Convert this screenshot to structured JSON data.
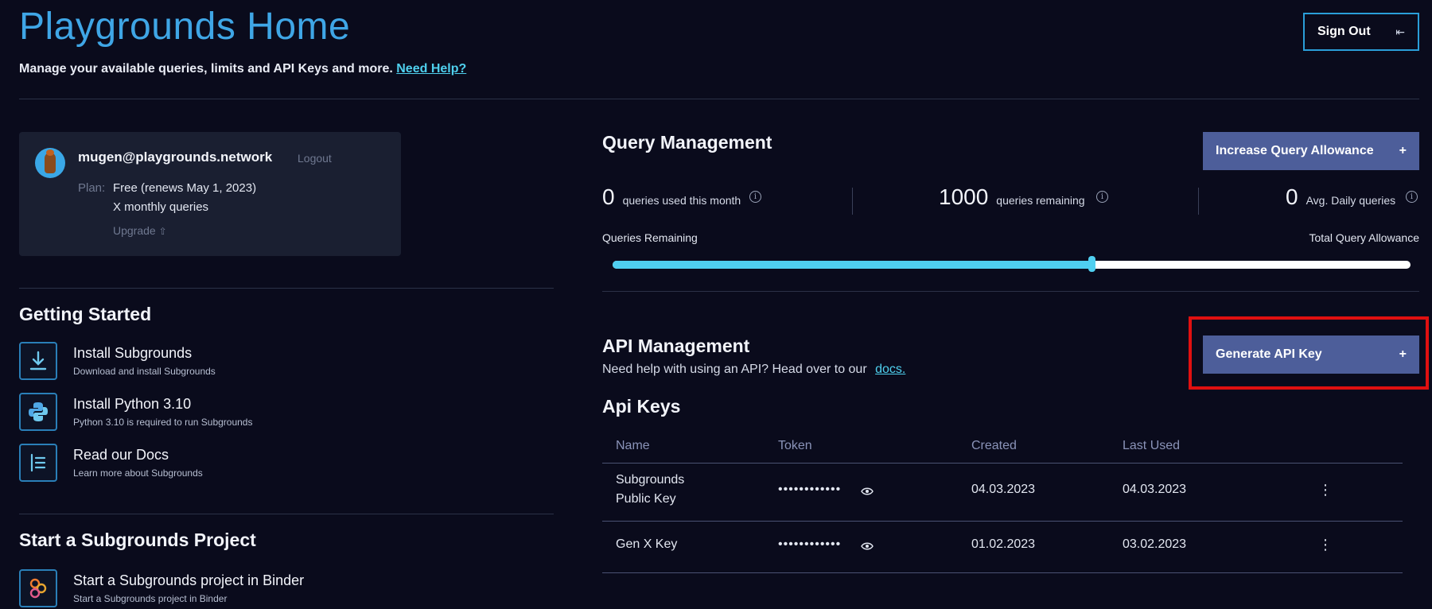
{
  "header": {
    "title": "Playgrounds Home",
    "subtitle": "Manage your available queries, limits and API Keys and more.",
    "help_link": "Need Help?",
    "signout_label": "Sign Out",
    "signout_icon": "exit-arrow-icon"
  },
  "user_card": {
    "email": "mugen@playgrounds.network",
    "logout_label": "Logout",
    "plan_label": "Plan:",
    "plan_value": "Free (renews May 1, 2023)",
    "plan_queries": "X monthly queries",
    "upgrade_label": "Upgrade"
  },
  "getting_started": {
    "heading": "Getting Started",
    "items": [
      {
        "title": "Install Subgrounds",
        "subtitle": "Download and install Subgrounds",
        "icon": "download-icon"
      },
      {
        "title": "Install Python 3.10",
        "subtitle": "Python 3.10 is required to run Subgrounds",
        "icon": "python-icon"
      },
      {
        "title": "Read our Docs",
        "subtitle": "Learn more about Subgrounds",
        "icon": "docs-icon"
      }
    ]
  },
  "project": {
    "heading": "Start a Subgrounds Project",
    "items": [
      {
        "title": "Start a Subgrounds project in Binder",
        "subtitle": "Start a Subgrounds project in Binder",
        "icon": "binder-icon"
      }
    ]
  },
  "query_management": {
    "heading": "Query Management",
    "increase_label": "Increase Query Allowance",
    "stats": [
      {
        "value": "0",
        "label": "queries used this month"
      },
      {
        "value": "1000",
        "label": "queries remaining"
      },
      {
        "value": "0",
        "label": "Avg. Daily queries"
      }
    ],
    "slider_left_label": "Queries Remaining",
    "slider_right_label": "Total Query Allowance",
    "slider_fraction": 0.6
  },
  "api_management": {
    "heading": "API Management",
    "help_text": "Need help with using an API? Head over to our",
    "docs_link": "docs.",
    "generate_label": "Generate API Key",
    "keys_heading": "Api Keys",
    "columns": [
      "Name",
      "Token",
      "Created",
      "Last Used"
    ],
    "rows": [
      {
        "name_line1": "Subgrounds",
        "name_line2": "Public Key",
        "token": "••••••••••••",
        "created": "04.03.2023",
        "last_used": "04.03.2023"
      },
      {
        "name_line1": "Gen X Key",
        "name_line2": "",
        "token": "••••••••••••",
        "created": "01.02.2023",
        "last_used": "03.02.2023"
      }
    ]
  },
  "colors": {
    "background": "#0a0b1c",
    "title": "#3fa6e6",
    "accent": "#4fcff0",
    "button": "#4d5e9a",
    "highlight": "#e01010"
  }
}
